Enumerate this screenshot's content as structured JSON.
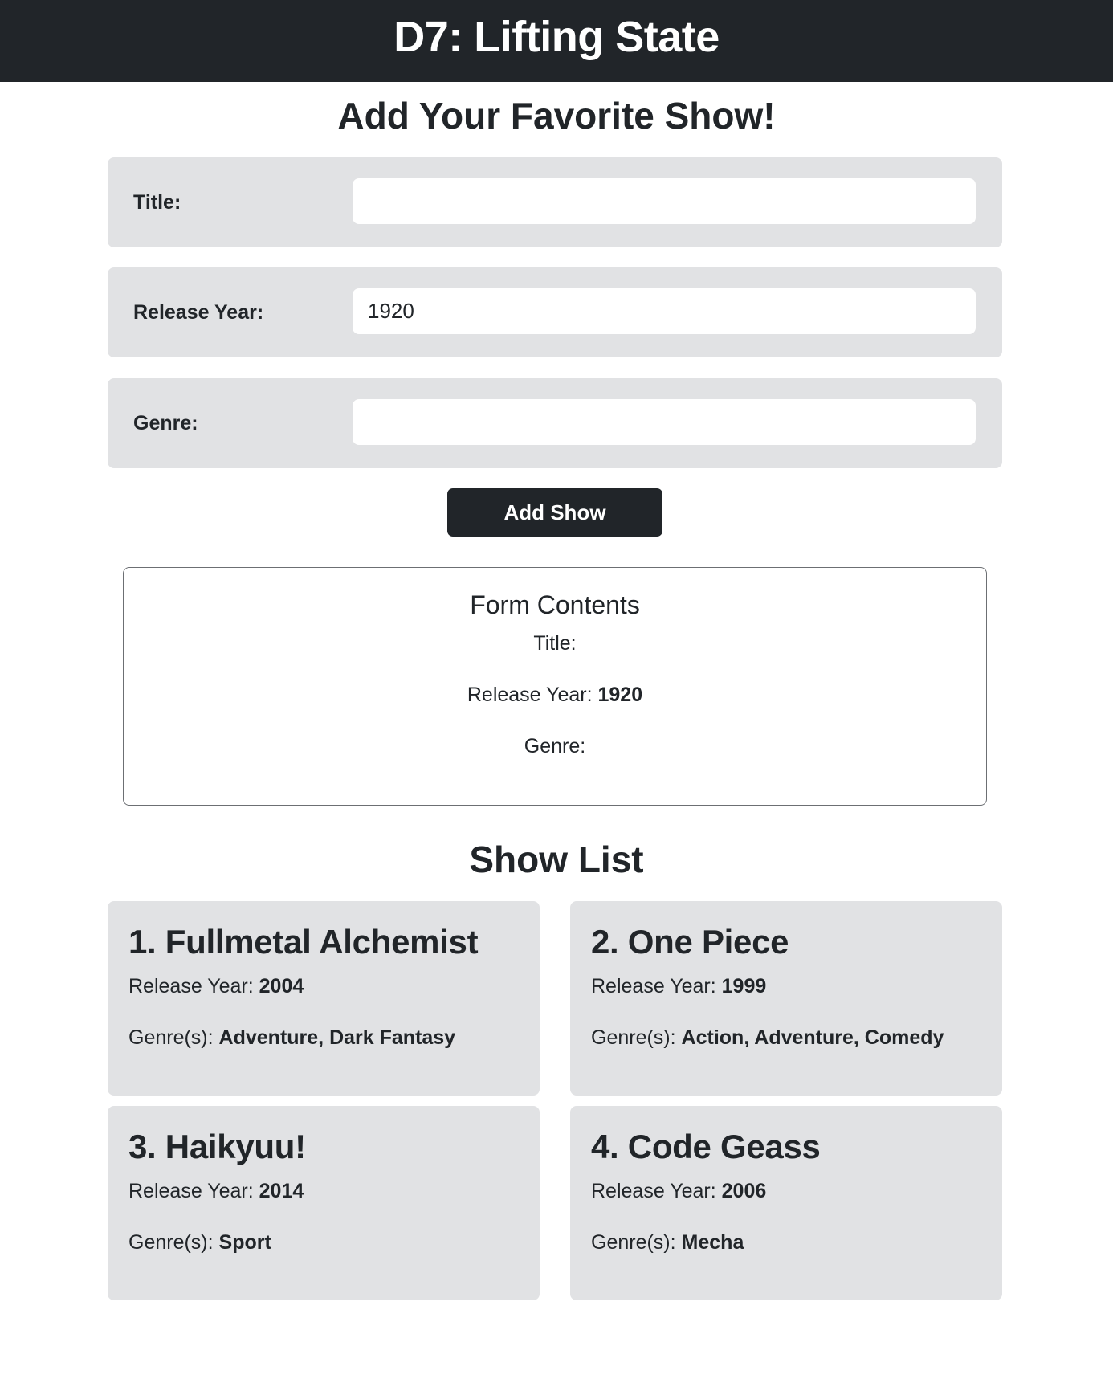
{
  "header": {
    "title": "D7: Lifting State"
  },
  "form": {
    "heading": "Add Your Favorite Show!",
    "fields": [
      {
        "label": "Title:",
        "value": "",
        "placeholder": ""
      },
      {
        "label": "Release Year:",
        "value": "1920",
        "placeholder": ""
      },
      {
        "label": "Genre:",
        "value": "",
        "placeholder": ""
      }
    ],
    "submit_label": "Add Show"
  },
  "form_contents": {
    "heading": "Form Contents",
    "title_label": "Title:",
    "title_value": "",
    "year_label": "Release Year:",
    "year_value": "1920",
    "genre_label": "Genre:",
    "genre_value": ""
  },
  "show_list": {
    "heading": "Show List",
    "year_label": "Release Year:",
    "genre_label": "Genre(s):",
    "shows": [
      {
        "title": "1. Fullmetal Alchemist",
        "year": "2004",
        "genres": "Adventure, Dark Fantasy"
      },
      {
        "title": "2. One Piece",
        "year": "1999",
        "genres": "Action, Adventure, Comedy"
      },
      {
        "title": "3. Haikyuu!",
        "year": "2014",
        "genres": "Sport"
      },
      {
        "title": "4. Code Geass",
        "year": "2006",
        "genres": "Mecha"
      }
    ]
  },
  "colors": {
    "header_bg": "#212529",
    "panel_bg": "#e1e2e4",
    "button_bg": "#212529"
  }
}
